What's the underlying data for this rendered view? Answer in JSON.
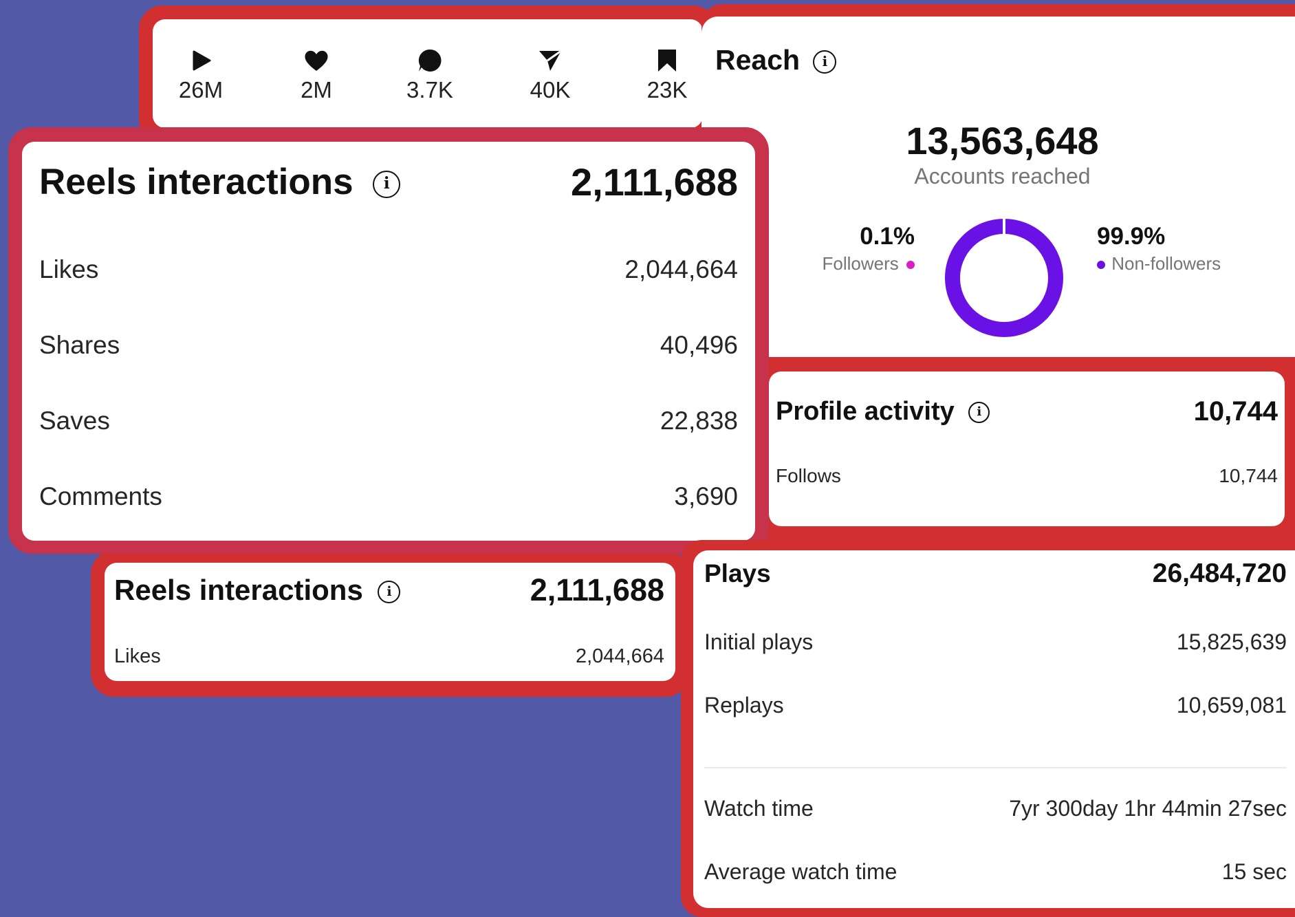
{
  "stats": [
    {
      "icon": "play-icon",
      "value": "26M"
    },
    {
      "icon": "heart-icon",
      "value": "2M"
    },
    {
      "icon": "comment-icon",
      "value": "3.7K"
    },
    {
      "icon": "share-icon",
      "value": "40K"
    },
    {
      "icon": "bookmark-icon",
      "value": "23K"
    }
  ],
  "reach": {
    "title": "Reach",
    "total": "13,563,648",
    "total_label": "Accounts reached",
    "followers_pct": "0.1%",
    "followers_label": "Followers",
    "nonfollowers_pct": "99.9%",
    "nonfollowers_label": "Non-followers",
    "followers_share": 0.001,
    "colors": {
      "followers": "#d81ec4",
      "nonfollowers": "#6a12e6"
    }
  },
  "reels_interactions": {
    "title": "Reels interactions",
    "total": "2,111,688",
    "rows": [
      {
        "label": "Likes",
        "value": "2,044,664"
      },
      {
        "label": "Shares",
        "value": "40,496"
      },
      {
        "label": "Saves",
        "value": "22,838"
      },
      {
        "label": "Comments",
        "value": "3,690"
      }
    ]
  },
  "profile_activity": {
    "title": "Profile activity",
    "total": "10,744",
    "rows": [
      {
        "label": "Follows",
        "value": "10,744"
      }
    ]
  },
  "reels_interactions_small": {
    "title": "Reels interactions",
    "total": "2,111,688",
    "rows": [
      {
        "label": "Likes",
        "value": "2,044,664"
      }
    ]
  },
  "plays": {
    "title": "Plays",
    "total": "26,484,720",
    "rows": [
      {
        "label": "Initial plays",
        "value": "15,825,639"
      },
      {
        "label": "Replays",
        "value": "10,659,081"
      }
    ],
    "watch_rows": [
      {
        "label": "Watch time",
        "value": "7yr 300day 1hr 44min 27sec"
      },
      {
        "label": "Average watch time",
        "value": "15 sec"
      }
    ]
  },
  "info_glyph": "i"
}
